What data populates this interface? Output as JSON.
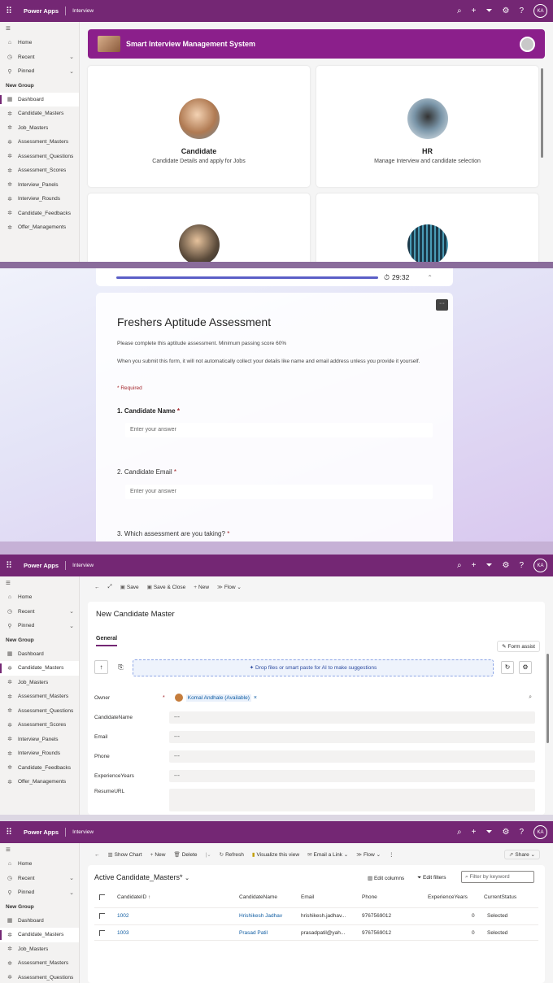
{
  "shared": {
    "app_name": "Power Apps",
    "environment": "Interview",
    "user_initials": "KA",
    "accent": "#742774"
  },
  "panel1": {
    "sidebar": {
      "items_top": [
        {
          "label": "Home",
          "icon": "home-icon"
        },
        {
          "label": "Recent",
          "icon": "clock-icon"
        },
        {
          "label": "Pinned",
          "icon": "pin-icon"
        }
      ],
      "group": "New Group",
      "items": [
        "Dashboard",
        "Candidate_Masters",
        "Job_Masters",
        "Assessment_Masters",
        "Assessment_Questions",
        "Assessment_Scores",
        "Interview_Panels",
        "Interview_Rounds",
        "Candidate_Feedbacks",
        "Offer_Managements"
      ]
    },
    "banner_title": "Smart Interview Management System",
    "cards": [
      {
        "title": "Candidate",
        "subtitle": "Candidate Details and apply for Jobs"
      },
      {
        "title": "HR",
        "subtitle": "Manage Interview and candidate selection"
      }
    ]
  },
  "panel2": {
    "timer": "29:32",
    "title": "Freshers Aptitude Assessment",
    "description": "Please complete this aptitude assessment. Minimum passing score 60%",
    "notice": "When you submit this form, it will not automatically collect your details like name and email address unless you provide it yourself.",
    "required": "* Required",
    "q1": "1. Candidate Name",
    "q1_placeholder": "Enter your answer",
    "q2": "2. Candidate Email",
    "q2_placeholder": "Enter your answer",
    "q3": "3. Which assessment are you taking?",
    "star": "*"
  },
  "panel3": {
    "sidebar_items_top": [
      "Home",
      "Recent",
      "Pinned"
    ],
    "group": "New Group",
    "sidebar_items": [
      "Dashboard",
      "Candidate_Masters",
      "Job_Masters",
      "Assessment_Masters",
      "Assessment_Questions",
      "Assessment_Scores",
      "Interview_Panels",
      "Interview_Rounds",
      "Candidate_Feedbacks",
      "Offer_Managements"
    ],
    "toolbar": {
      "save": "Save",
      "save_close": "Save & Close",
      "new": "New",
      "flow": "Flow"
    },
    "form_title": "New Candidate Master",
    "tab": "General",
    "form_assist": "Form assist",
    "dropzone": "Drop files or smart paste for AI to make suggestions",
    "fields": [
      {
        "label": "Owner",
        "value": "Komal Andhale (Available)"
      },
      {
        "label": "CandidateName",
        "value": "---"
      },
      {
        "label": "Email",
        "value": "---"
      },
      {
        "label": "Phone",
        "value": "---"
      },
      {
        "label": "ExperienceYears",
        "value": "---"
      },
      {
        "label": "ResumeURL",
        "value": ""
      }
    ]
  },
  "panel4": {
    "sidebar_items_top": [
      "Home",
      "Recent",
      "Pinned"
    ],
    "group": "New Group",
    "sidebar_items": [
      "Dashboard",
      "Candidate_Masters",
      "Job_Masters",
      "Assessment_Masters",
      "Assessment_Questions"
    ],
    "toolbar": {
      "show_chart": "Show Chart",
      "new": "New",
      "delete": "Delete",
      "refresh": "Refresh",
      "visualize": "Visualize this view",
      "email_link": "Email a Link",
      "flow": "Flow",
      "share": "Share"
    },
    "view_title": "Active Candidate_Masters*",
    "edit_columns": "Edit columns",
    "edit_filters": "Edit filters",
    "filter_placeholder": "Filter by keyword",
    "columns": [
      "CandidateID ↑",
      "CandidateName",
      "Email",
      "Phone",
      "ExperienceYears",
      "CurrentStatus"
    ],
    "rows": [
      [
        "1002",
        "Hrishikesh Jadhav",
        "hrishikesh.jadhav...",
        "9767569012",
        "0",
        "Selected"
      ],
      [
        "1003",
        "Prasad Patil",
        "prasadpatil@yah...",
        "9767569012",
        "0",
        "Selected"
      ]
    ]
  }
}
